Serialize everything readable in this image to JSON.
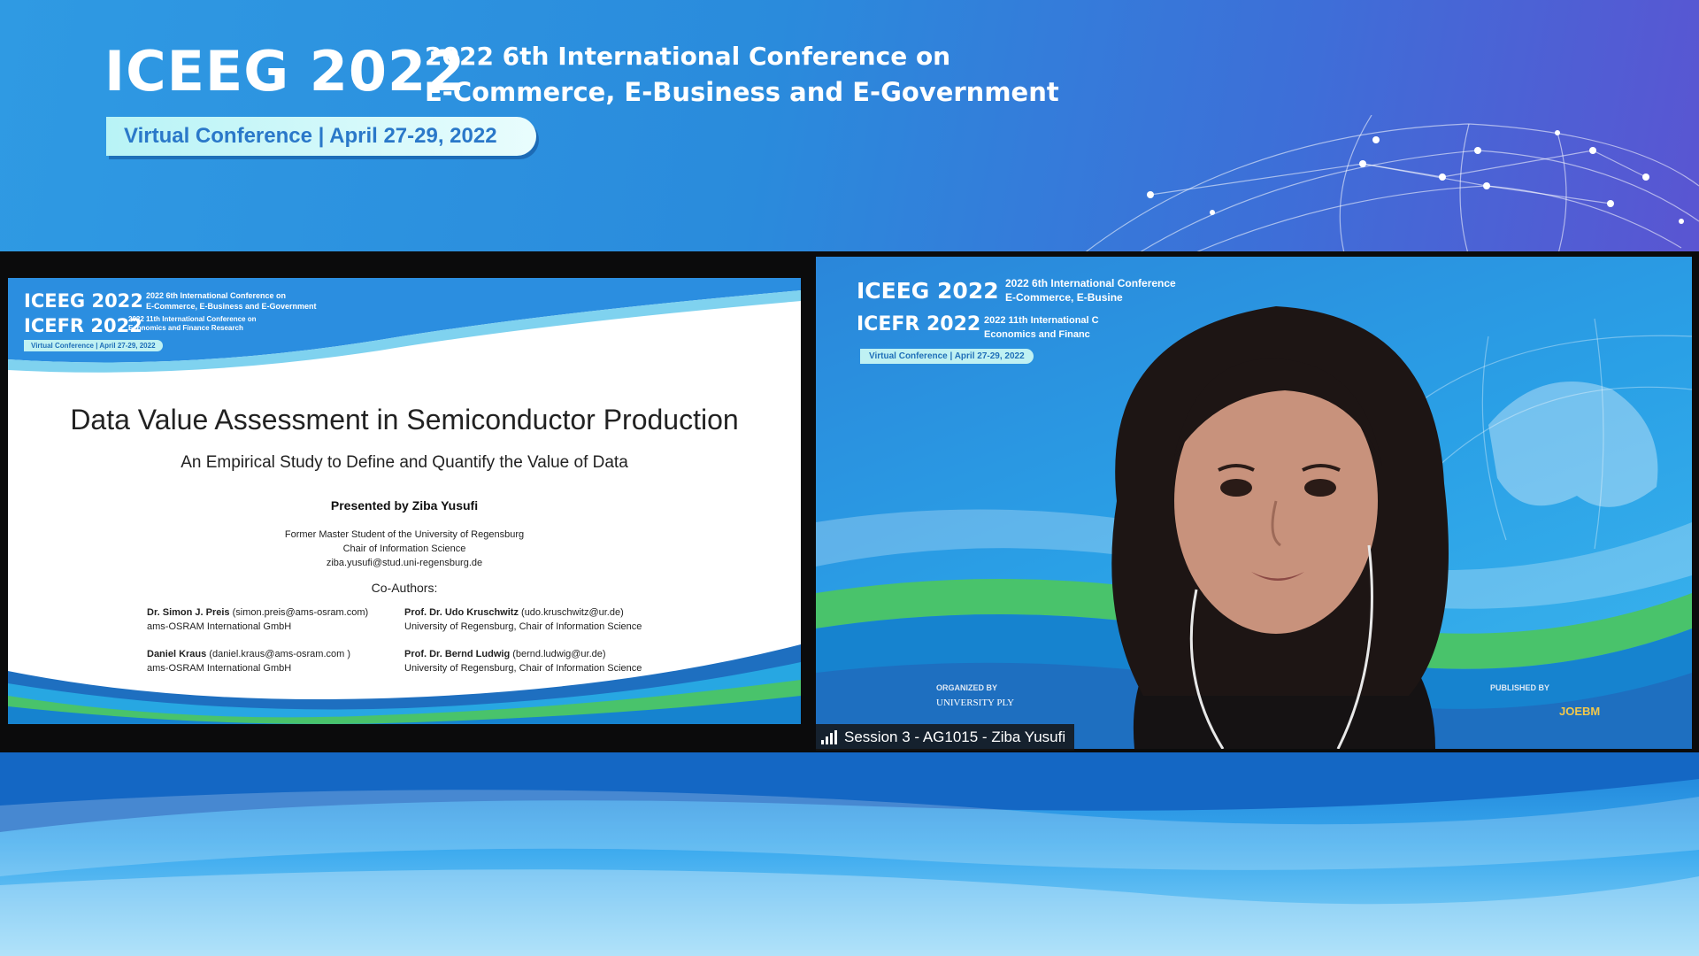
{
  "banner": {
    "title": "ICEEG 2022",
    "subtitle_line1": "2022 6th International Conference on",
    "subtitle_line2": "E-Commerce, E-Business and E-Government",
    "pill": "Virtual Conference | April 27-29, 2022"
  },
  "slide": {
    "logo1": "ICEEG 2022",
    "logo1_sub": [
      "2022 6th International Conference on",
      "E-Commerce, E-Business and E-Government"
    ],
    "logo2": "ICEFR 2022",
    "logo2_sub": [
      "2022 11th International Conference on",
      "Economics and Finance Research"
    ],
    "pill": "Virtual Conference | April 27-29, 2022",
    "title": "Data Value Assessment in Semiconductor Production",
    "subtitle": "An Empirical Study to Define and Quantify the Value of Data",
    "presented_by": "Presented by Ziba Yusufi",
    "affiliation": [
      "Former Master Student of the University of Regensburg",
      "Chair of Information Science",
      "ziba.yusufi@stud.uni-regensburg.de"
    ],
    "coauthors_label": "Co-Authors:",
    "authors": [
      {
        "name": "Dr. Simon J. Preis",
        "email": " (simon.preis@ams-osram.com)",
        "org": "ams-OSRAM International GmbH"
      },
      {
        "name": "Prof. Dr. Udo Kruschwitz",
        "email": " (udo.kruschwitz@ur.de)",
        "org": "University of Regensburg, Chair of Information Science"
      },
      {
        "name": "Daniel Kraus",
        "email": " (daniel.kraus@ams-osram.com )",
        "org": "ams-OSRAM International GmbH"
      },
      {
        "name": "Prof. Dr. Bernd Ludwig",
        "email": " (bernd.ludwig@ur.de)",
        "org": "University of Regensburg, Chair of Information Science"
      }
    ]
  },
  "video": {
    "logo1": "ICEEG 2022",
    "logo1_sub": [
      "2022 6th International Conference",
      "E-Commerce, E-Busine"
    ],
    "logo2": "ICEFR 2022",
    "logo2_sub": [
      "2022 11th International C",
      "Economics and Financ"
    ],
    "pill": "Virtual Conference | April 27-29, 2022",
    "organized_by": "ORGANIZED BY",
    "university": "UNIVERSITY PLY",
    "published_by": "PUBLISHED BY",
    "publisher": "JOEBM",
    "caption": "Session 3 - AG1015 - Ziba Yusufi"
  },
  "colors": {
    "accent": "#2f9ae3",
    "pill": "#bff1f3",
    "stage": "#0b0b0c"
  }
}
